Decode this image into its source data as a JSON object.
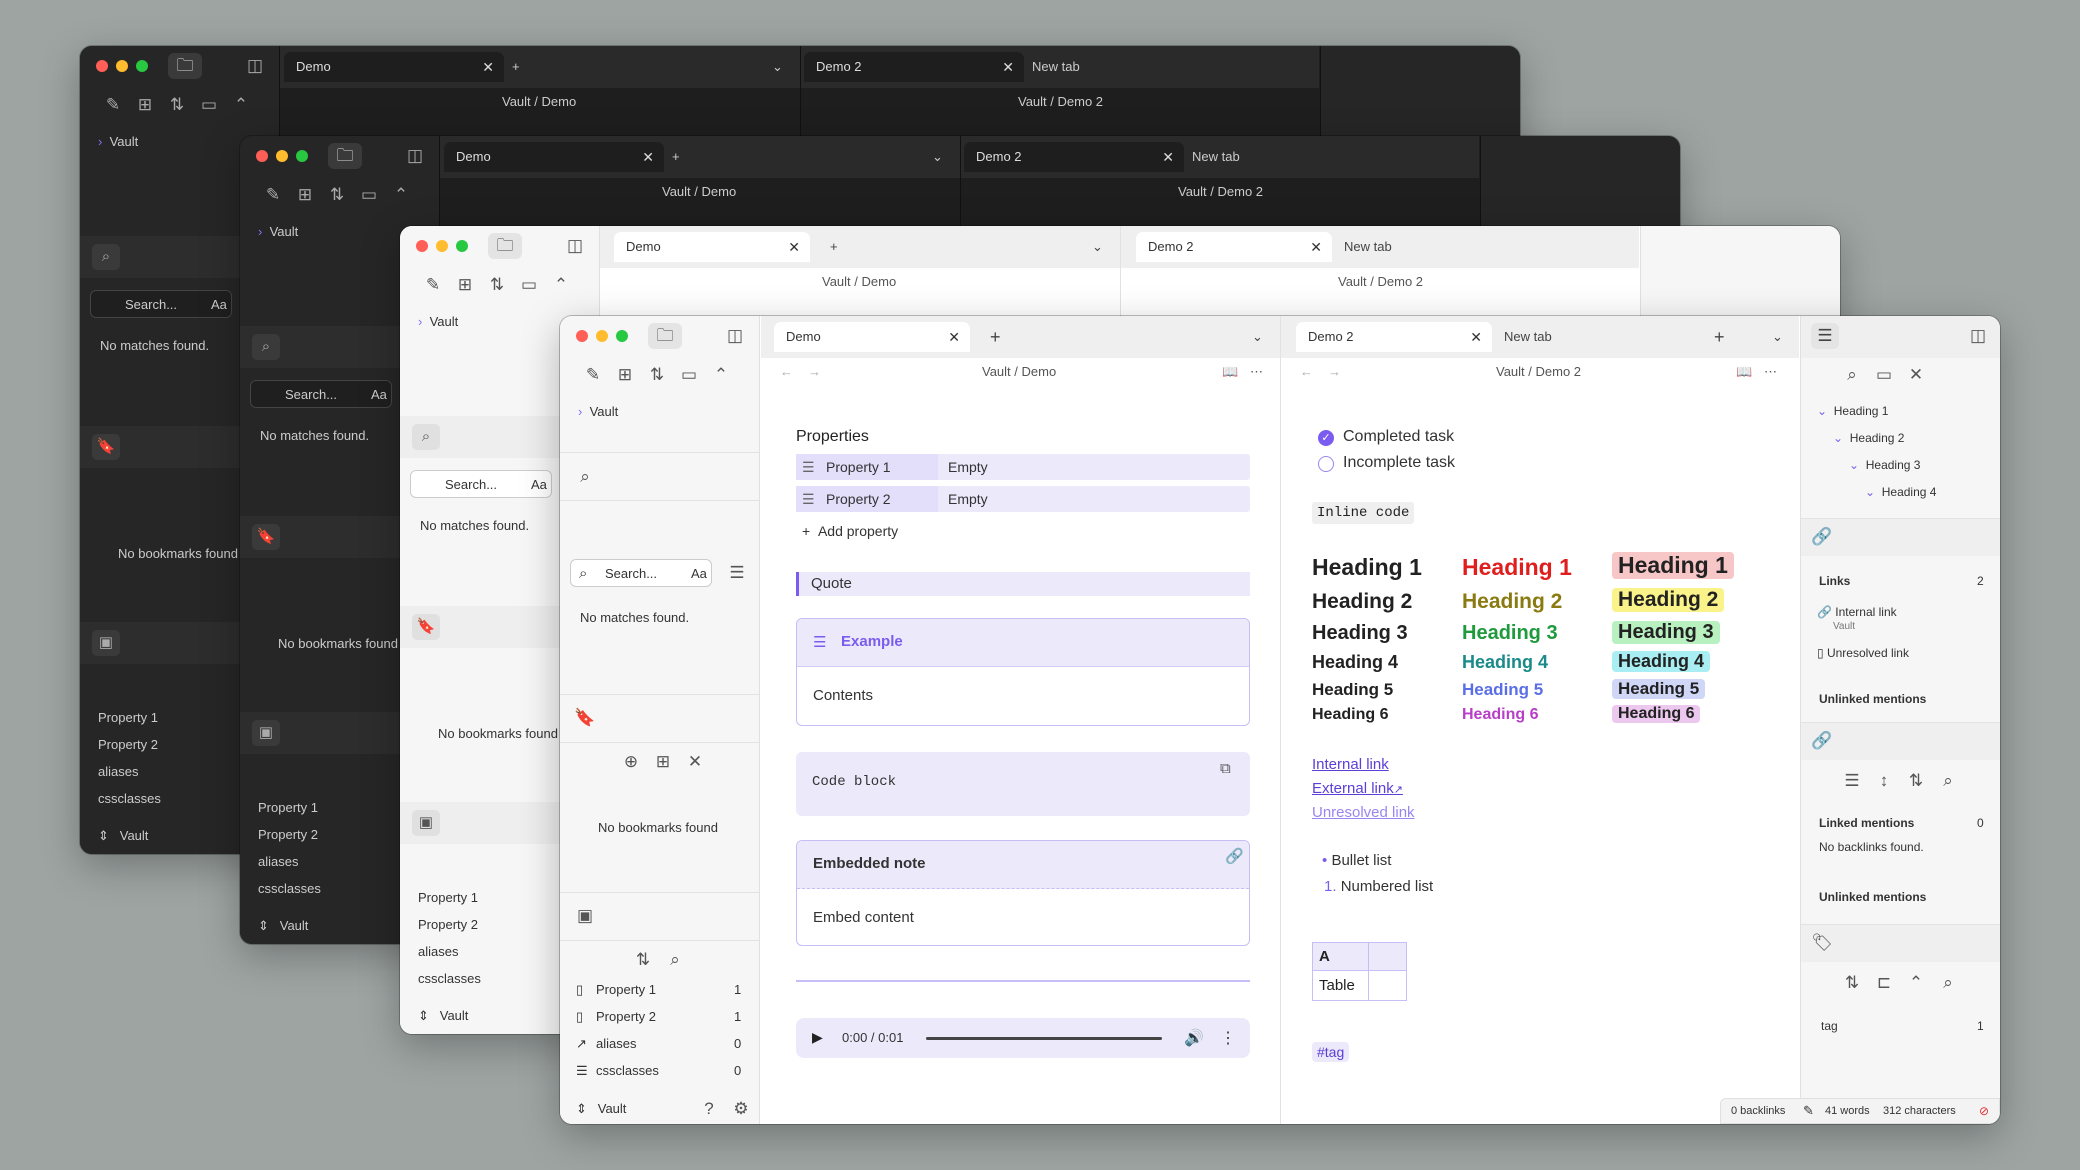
{
  "tabs": {
    "demo": "Demo",
    "demo2": "Demo 2",
    "new_tab": "New tab"
  },
  "breadcrumbs": {
    "left": "Vault / Demo",
    "right": "Vault / Demo 2"
  },
  "file_explorer": {
    "vault": "Vault"
  },
  "search": {
    "placeholder": "Search...",
    "match_case": "Aa",
    "empty": "No matches found."
  },
  "bookmarks": {
    "empty": "No bookmarks found"
  },
  "all_properties": {
    "items": [
      {
        "name": "Property 1",
        "count": "1",
        "icon": "file-icon"
      },
      {
        "name": "Property 2",
        "count": "1",
        "icon": "file-icon"
      },
      {
        "name": "aliases",
        "count": "0",
        "icon": "forward-icon"
      },
      {
        "name": "cssclasses",
        "count": "0",
        "icon": "list-icon"
      }
    ]
  },
  "vault_switcher": {
    "label": "Vault"
  },
  "note1": {
    "properties_title": "Properties",
    "properties": [
      {
        "key": "Property 1",
        "value": "Empty"
      },
      {
        "key": "Property 2",
        "value": "Empty"
      }
    ],
    "add_property": "Add property",
    "quote": "Quote",
    "callout": {
      "title": "Example",
      "content": "Contents"
    },
    "code": "Code block",
    "embed": {
      "title": "Embedded note",
      "content": "Embed content"
    },
    "audio": {
      "time": "0:00 / 0:01"
    }
  },
  "note2": {
    "tasks": [
      {
        "label": "Completed task",
        "done": true
      },
      {
        "label": "Incomplete task",
        "done": false
      }
    ],
    "inline_code": "Inline code",
    "headings": [
      "Heading 1",
      "Heading 2",
      "Heading 3",
      "Heading 4",
      "Heading 5",
      "Heading 6"
    ],
    "heading_colors": [
      "#e01e1e",
      "#8a7a10",
      "#1f9a3c",
      "#1a8a8a",
      "#5a6ee6",
      "#b83ec8"
    ],
    "heading_highlights": [
      "#f7c6c6",
      "#f9f38a",
      "#b8f0c0",
      "#a8eef2",
      "#cfd6f6",
      "#ecc8ee"
    ],
    "links": {
      "internal": "Internal link",
      "external": "External link",
      "unresolved": "Unresolved link"
    },
    "bullet": "Bullet list",
    "numbered": "Numbered list",
    "numbered_marker": "1.",
    "table": {
      "header": "A",
      "row": "Table"
    },
    "tag": "#tag"
  },
  "outline": [
    "Heading 1",
    "Heading 2",
    "Heading 3",
    "Heading 4"
  ],
  "backlinks": {
    "links_title": "Links",
    "links_count": "2",
    "internal": "Internal link",
    "internal_sub": "Vault",
    "unresolved": "Unresolved link",
    "unlinked": "Unlinked mentions",
    "linked": "Linked mentions",
    "linked_count": "0",
    "no_backlinks": "No backlinks found."
  },
  "tags": {
    "name": "tag",
    "count": "1"
  },
  "status": {
    "backlinks": "0 backlinks",
    "words": "41 words",
    "chars": "312 characters"
  },
  "accent": "#7b5cf0"
}
